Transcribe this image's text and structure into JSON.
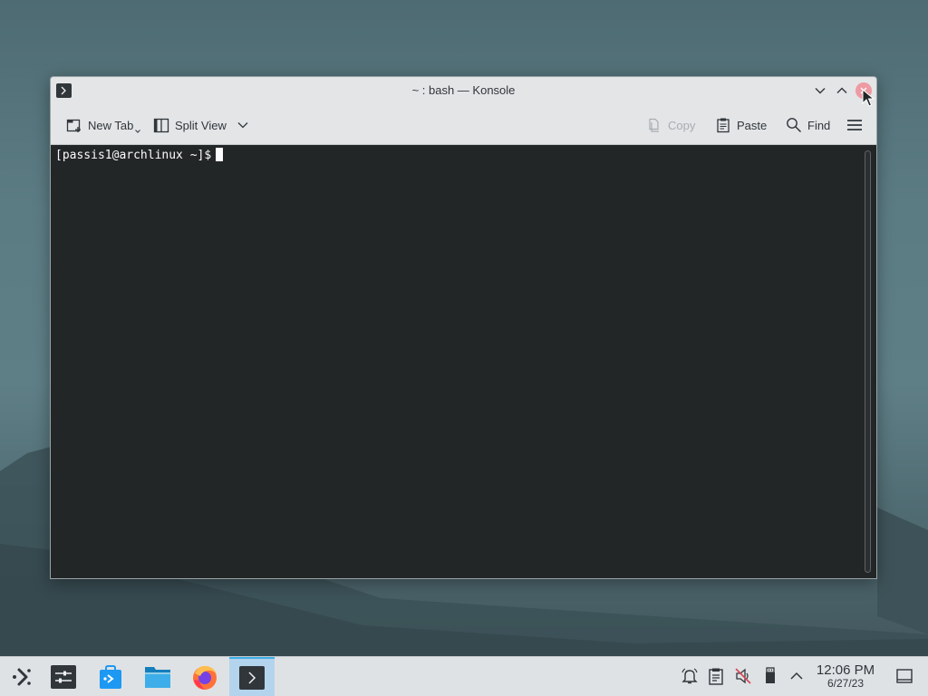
{
  "window": {
    "title": "~ : bash — Konsole",
    "icon": "konsole-icon"
  },
  "toolbar": {
    "new_tab": "New Tab",
    "split_view": "Split View",
    "copy": "Copy",
    "paste": "Paste",
    "find": "Find"
  },
  "terminal": {
    "prompt": "[passis1@archlinux ~]$"
  },
  "taskbar": {
    "apps": [
      {
        "name": "application-launcher",
        "icon": "launcher-icon"
      },
      {
        "name": "system-settings",
        "icon": "settings-icon"
      },
      {
        "name": "discover",
        "icon": "discover-icon"
      },
      {
        "name": "dolphin",
        "icon": "folder-icon"
      },
      {
        "name": "firefox",
        "icon": "firefox-icon"
      },
      {
        "name": "konsole",
        "icon": "konsole-icon",
        "active": true
      }
    ],
    "tray": [
      "notifications-icon",
      "clipboard-icon",
      "volume-muted-icon",
      "usb-device-icon",
      "expand-tray-icon"
    ],
    "time": "12:06 PM",
    "date": "6/27/23"
  },
  "colors": {
    "terminal_bg": "#232627",
    "accent": "#3daee9",
    "close_button": "#ee9aa2"
  }
}
